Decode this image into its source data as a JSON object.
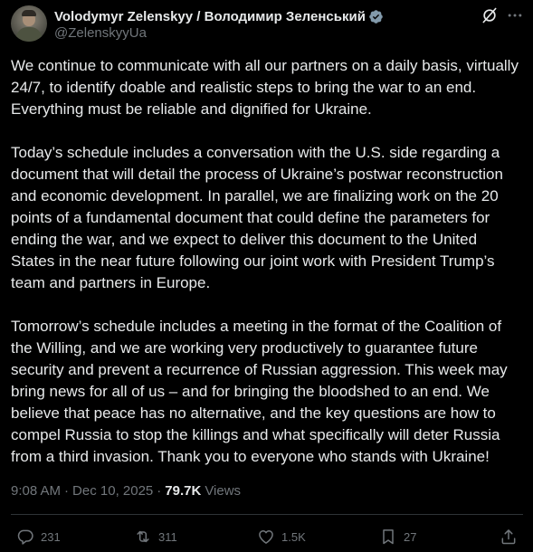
{
  "author": {
    "display_name": "Volodymyr Zelenskyy / Володимир Зеленський",
    "handle": "@ZelenskyyUa",
    "verified_color": "#829aab"
  },
  "tweet": {
    "paragraphs": [
      "We continue to communicate with all our partners on a daily basis, virtually 24/7, to identify doable and realistic steps to bring the war to an end. Everything must be reliable and dignified for Ukraine.",
      "Today’s schedule includes a conversation with the U.S. side regarding a document that will detail the process of Ukraine’s postwar reconstruction and economic development. In parallel, we are finalizing work on the 20 points of a fundamental document that could define the parameters for ending the war, and we expect to deliver this document to the United States in the near future following our joint work with President Trump’s team and partners in Europe.",
      "Tomorrow’s schedule includes a meeting in the format of the Coalition of the Willing, and we are working very productively to guarantee future security and prevent a recurrence of Russian aggression. This week may bring news for all of us – and for bringing the bloodshed to an end. We believe that peace has no alternative, and the key questions are how to compel Russia to stop the killings and what specifically will deter Russia from a third invasion. Thank you to everyone who stands with Ukraine!"
    ]
  },
  "meta": {
    "time": "9:08 AM",
    "separator": "·",
    "date": "Dec 10, 2025",
    "views_count": "79.7K",
    "views_label": "Views"
  },
  "actions": {
    "replies": "231",
    "reposts": "311",
    "likes": "1.5K",
    "bookmarks": "27"
  },
  "icons": {
    "verified": "verified-badge-icon",
    "grok": "grok-icon",
    "more": "more-horizontal-icon",
    "reply": "reply-icon",
    "repost": "repost-icon",
    "like": "heart-icon",
    "bookmark": "bookmark-icon",
    "share": "share-icon"
  },
  "colors": {
    "background": "#000000",
    "text_primary": "#e7e9ea",
    "text_secondary": "#71767b",
    "divider": "#2f3336"
  }
}
